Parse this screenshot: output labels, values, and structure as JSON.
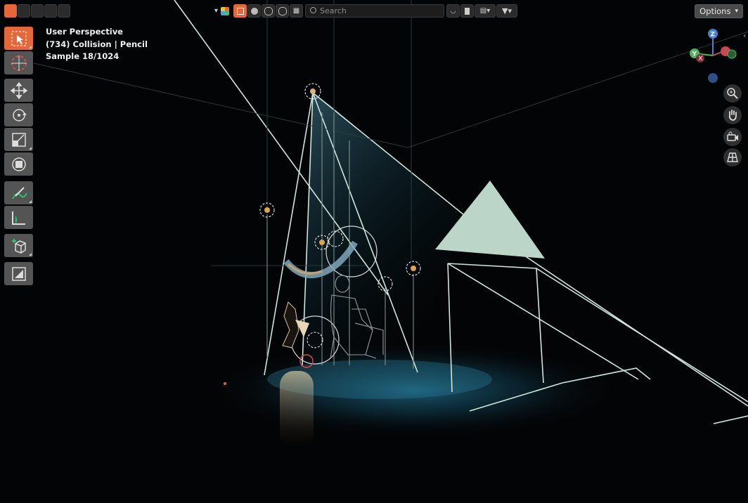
{
  "overlay": {
    "view_name": "User Perspective",
    "object_info": "(734) Collision | Pencil",
    "render_progress": "Sample 18/1024"
  },
  "header": {
    "search_placeholder": "Search",
    "options_label": "Options"
  },
  "gizmo": {
    "x_label": "X",
    "y_label": "Y",
    "z_label": "Z"
  },
  "toolbar": {
    "tools": [
      "select-box",
      "cursor",
      "move",
      "rotate",
      "scale",
      "transform",
      "annotate",
      "measure",
      "add-cube",
      "extrude"
    ]
  },
  "colors": {
    "accent": "#e5683a",
    "wire": "#cfe6dd",
    "spot": "#49a9c8"
  }
}
